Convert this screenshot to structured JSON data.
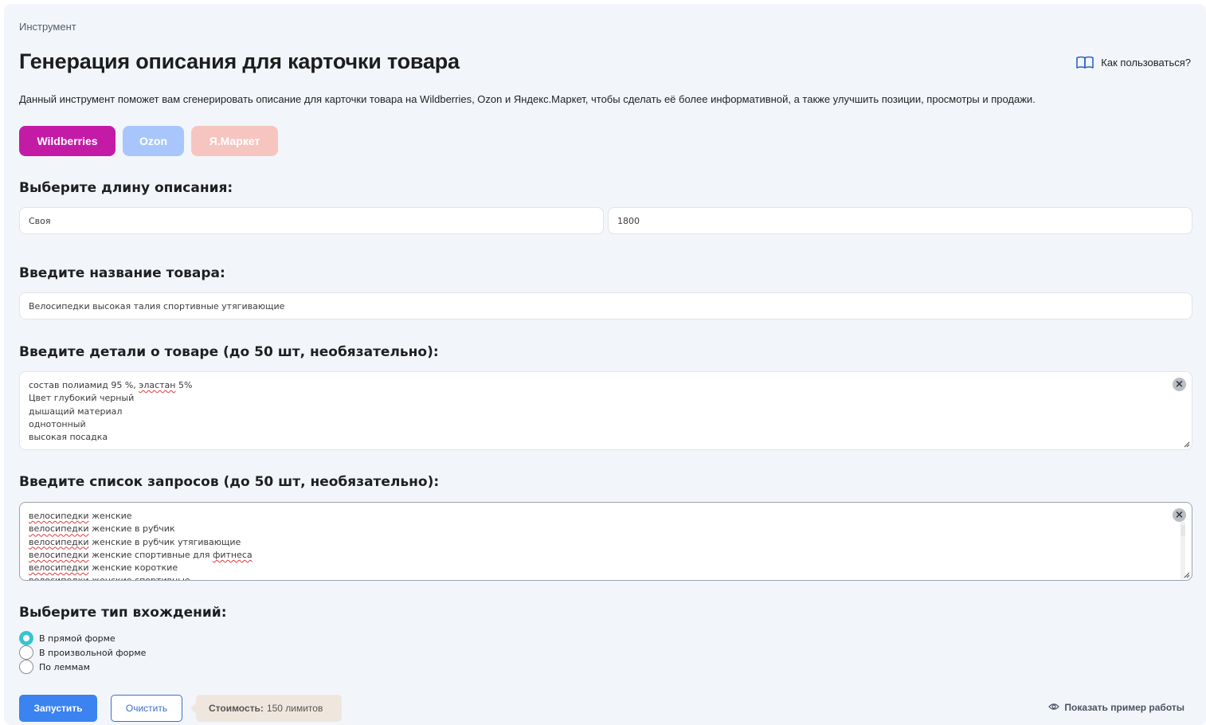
{
  "breadcrumb": "Инструмент",
  "page_title": "Генерация описания для карточки товара",
  "howto_label": "Как пользоваться?",
  "description": "Данный инструмент поможет вам сгенерировать описание для карточки товара на Wildberries, Ozon и Яндекс.Маркет, чтобы сделать её более информативной, а также улучшить позиции, просмотры и продажи.",
  "marketplaces": [
    {
      "label": "Wildberries",
      "color": "#c41ba7",
      "active": true
    },
    {
      "label": "Ozon",
      "color": "#a8c6fb",
      "active": false
    },
    {
      "label": "Я.Маркет",
      "color": "#f6c5c0",
      "active": false
    }
  ],
  "length": {
    "heading": "Выберите длину описания:",
    "mode_value": "Своя",
    "custom_value": "1800"
  },
  "product_name": {
    "heading": "Введите название товара:",
    "value": "Велосипедки высокая талия спортивные утягивающие"
  },
  "details": {
    "heading": "Введите детали о товаре (до 50 шт, необязательно):",
    "lines": [
      "состав полиамид 95 %, эластан 5%",
      "Цвет глубокий черный",
      "дышащий материал",
      "однотонный",
      "высокая посадка"
    ]
  },
  "queries": {
    "heading": "Введите список запросов (до 50 шт, необязательно):",
    "lines": [
      "велосипедки женские",
      "велосипедки женские в рубчик",
      "велосипедки женские в рубчик утягивающие",
      "велосипедки женские спортивные для фитнеса",
      "велосипедки женские короткие",
      "велосипедки женские спортивные"
    ]
  },
  "occurrence": {
    "heading": "Выберите тип вхождений:",
    "options": [
      "В прямой форме",
      "В произвольной форме",
      "По леммам"
    ],
    "selected": 0
  },
  "actions": {
    "run_label": "Запустить",
    "clear_label": "Очистить",
    "cost_label": "Стоимость:",
    "cost_value": "150 лимитов",
    "example_label": "Показать пример работы"
  },
  "icons": {
    "howto": "book-icon",
    "example": "eye-icon",
    "clear": "close-circle-icon"
  }
}
